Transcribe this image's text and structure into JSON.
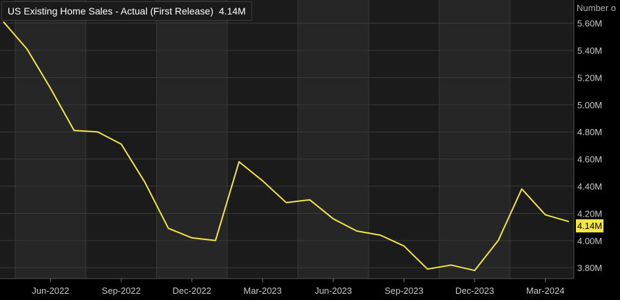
{
  "legend": {
    "series_name": "US Existing Home Sales - Actual (First Release)",
    "current_value": "4.14M"
  },
  "y_axis": {
    "unit_label": "Number o"
  },
  "last_value_badge": "4.14M",
  "colors": {
    "background": "#000000",
    "band_light": "#262626",
    "band_dark": "#1b1b1b",
    "grid": "#3a3a3a",
    "line": "#f5e642",
    "text": "#c8c8c8"
  },
  "chart_data": {
    "type": "line",
    "title": "",
    "xlabel": "",
    "ylabel": "Number o",
    "x": [
      "2022-04",
      "2022-05",
      "2022-06",
      "2022-07",
      "2022-08",
      "2022-09",
      "2022-10",
      "2022-11",
      "2022-12",
      "2023-01",
      "2023-02",
      "2023-03",
      "2023-04",
      "2023-05",
      "2023-06",
      "2023-07",
      "2023-08",
      "2023-09",
      "2023-10",
      "2023-11",
      "2023-12",
      "2024-01",
      "2024-02",
      "2024-03",
      "2024-04"
    ],
    "series": [
      {
        "name": "US Existing Home Sales - Actual (First Release)",
        "values": [
          5.61,
          5.41,
          5.12,
          4.81,
          4.8,
          4.71,
          4.43,
          4.09,
          4.02,
          4.0,
          4.58,
          4.44,
          4.28,
          4.3,
          4.16,
          4.07,
          4.04,
          3.96,
          3.79,
          3.82,
          3.78,
          4.0,
          4.38,
          4.19,
          4.14
        ]
      }
    ],
    "x_ticks": [
      "Jun-2022",
      "Sep-2022",
      "Dec-2022",
      "Mar-2023",
      "Jun-2023",
      "Sep-2023",
      "Dec-2023",
      "Mar-2024"
    ],
    "y_ticks": [
      "3.80M",
      "4.00M",
      "4.20M",
      "4.40M",
      "4.60M",
      "4.80M",
      "5.00M",
      "5.20M",
      "5.40M",
      "5.60M"
    ],
    "ylim": [
      3.72,
      5.72
    ],
    "grid": true
  }
}
